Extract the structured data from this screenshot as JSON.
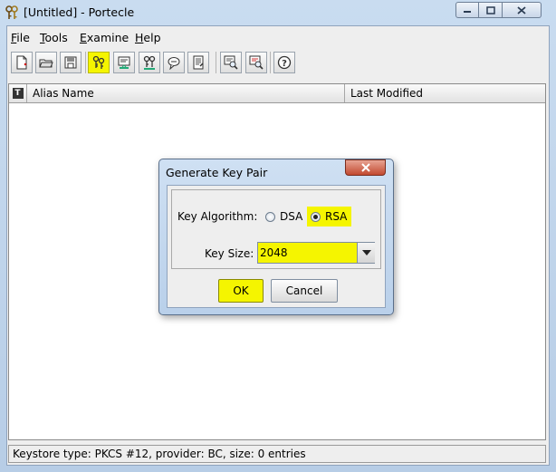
{
  "window": {
    "title": "[Untitled] - Portecle",
    "minimize": "minimize",
    "maximize": "maximize",
    "close": "close"
  },
  "menu": [
    {
      "first": "F",
      "rest": "ile"
    },
    {
      "first": "T",
      "rest": "ools"
    },
    {
      "first": "E",
      "rest": "xamine"
    },
    {
      "first": "H",
      "rest": "elp"
    }
  ],
  "toolbar": {
    "buttons": [
      {
        "name": "new-keystore-icon",
        "highlighted": false
      },
      {
        "name": "open-keystore-icon",
        "highlighted": false
      },
      {
        "name": "save-keystore-icon",
        "highlighted": false
      },
      {
        "name": "generate-key-pair-icon",
        "highlighted": true
      },
      {
        "name": "import-trusted-cert-icon",
        "highlighted": false
      },
      {
        "name": "import-key-pair-icon",
        "highlighted": false
      },
      {
        "name": "set-password-icon",
        "highlighted": false
      },
      {
        "name": "keystore-report-icon",
        "highlighted": false
      },
      {
        "name": "examine-certificate-icon",
        "highlighted": false
      },
      {
        "name": "examine-crl-icon",
        "highlighted": false
      },
      {
        "name": "help-icon",
        "highlighted": false
      }
    ],
    "highlight_color": "#f5f500"
  },
  "table": {
    "type_header": "T",
    "headers": [
      "Alias Name",
      "Last Modified"
    ],
    "rows": []
  },
  "status": {
    "text": "Keystore type: PKCS #12, provider: BC, size: 0 entries"
  },
  "dialog": {
    "title": "Generate Key Pair",
    "algorithm_label": "Key Algorithm:",
    "options": [
      {
        "label": "DSA",
        "selected": false
      },
      {
        "label": "RSA",
        "selected": true
      }
    ],
    "size_label": "Key Size:",
    "size_value": "2048",
    "ok_label": "OK",
    "cancel_label": "Cancel"
  }
}
